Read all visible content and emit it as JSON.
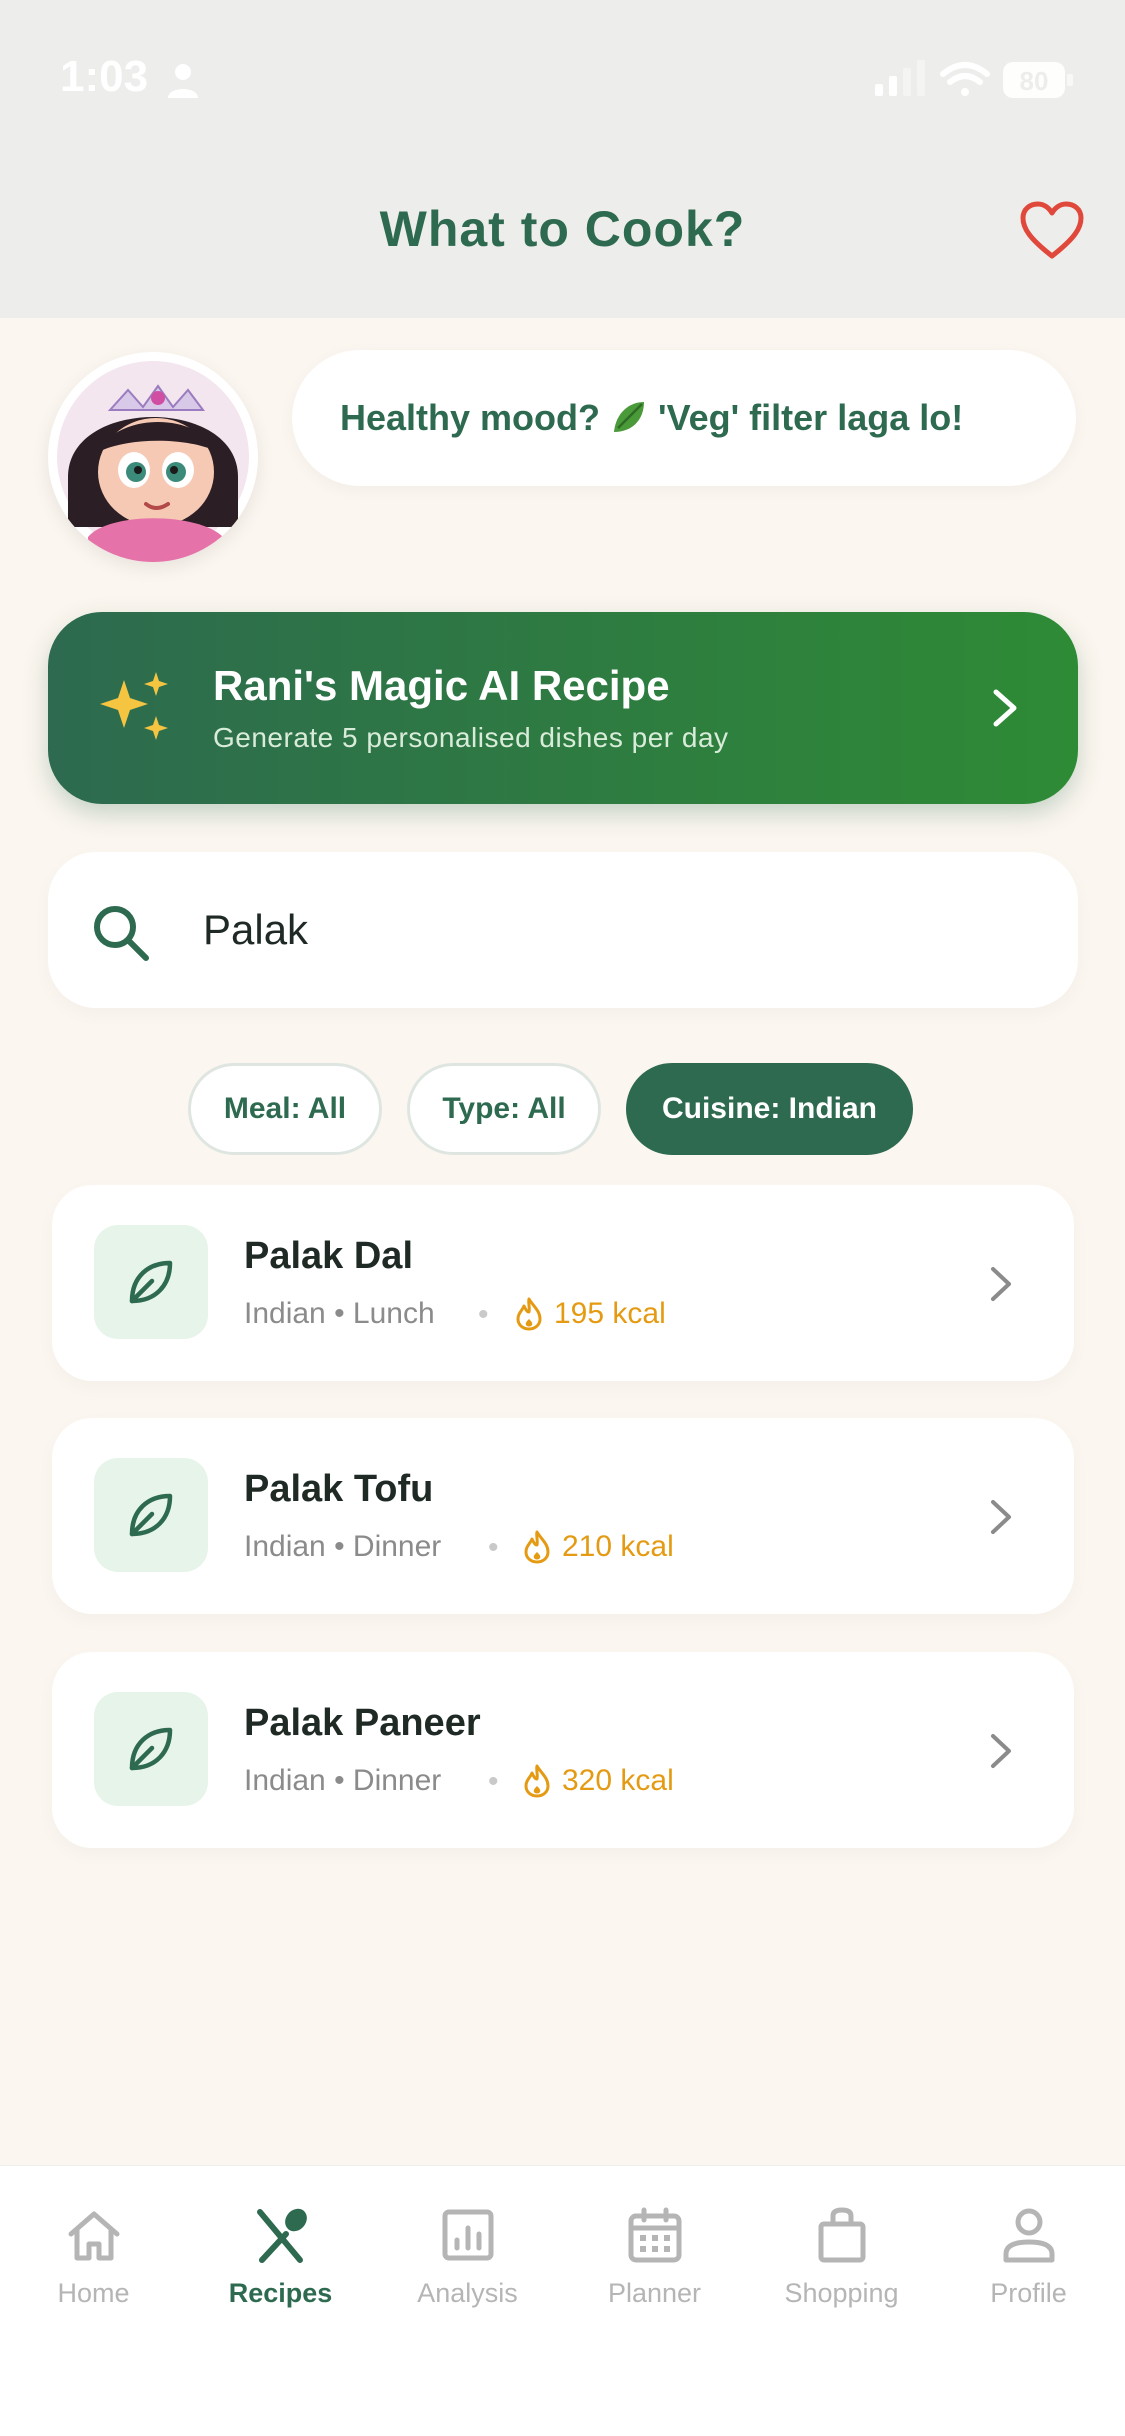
{
  "status_bar": {
    "time": "1:03",
    "battery": "80"
  },
  "header": {
    "title": "What to Cook?"
  },
  "mascot": {
    "bubble_text_before": "Healthy mood?",
    "bubble_text_after": "'Veg' filter laga lo!"
  },
  "magic_card": {
    "title": "Rani's Magic AI Recipe",
    "subtitle": "Generate 5 personalised dishes per day"
  },
  "search": {
    "value": "Palak"
  },
  "filters": [
    {
      "label": "Meal: All",
      "active": false
    },
    {
      "label": "Type: All",
      "active": false
    },
    {
      "label": "Cuisine: Indian",
      "active": true
    }
  ],
  "recipes": [
    {
      "name": "Palak Dal",
      "meta": "Indian • Lunch",
      "kcal": "195 kcal"
    },
    {
      "name": "Palak Tofu",
      "meta": "Indian • Dinner",
      "kcal": "210 kcal"
    },
    {
      "name": "Palak Paneer",
      "meta": "Indian • Dinner",
      "kcal": "320 kcal"
    }
  ],
  "nav": [
    {
      "label": "Home",
      "icon": "home-icon",
      "active": false
    },
    {
      "label": "Recipes",
      "icon": "utensils-icon",
      "active": true
    },
    {
      "label": "Analysis",
      "icon": "chart-icon",
      "active": false
    },
    {
      "label": "Planner",
      "icon": "calendar-icon",
      "active": false
    },
    {
      "label": "Shopping",
      "icon": "bag-icon",
      "active": false
    },
    {
      "label": "Profile",
      "icon": "person-icon",
      "active": false
    }
  ],
  "colors": {
    "primary": "#2d6a4f",
    "accent_green": "#2e8b35",
    "kcal_orange": "#e49b13",
    "heart_red": "#e0483b",
    "background": "#fbf6ef"
  }
}
